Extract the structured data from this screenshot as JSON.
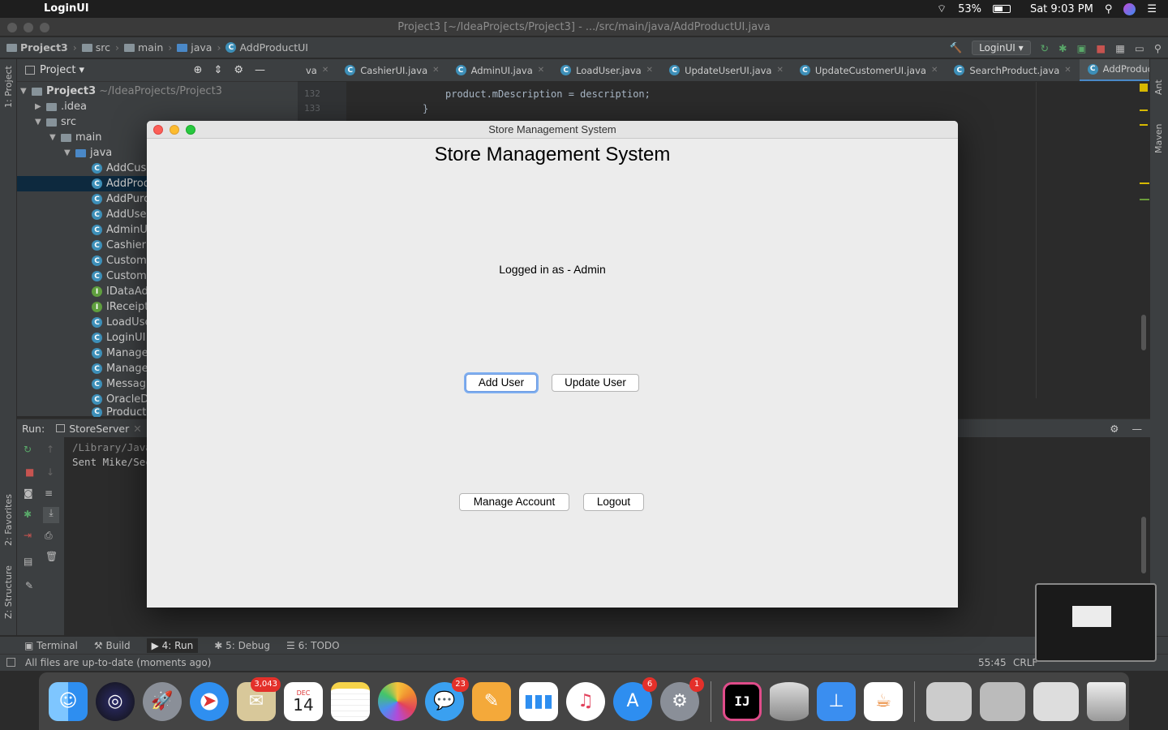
{
  "menubar": {
    "app_name": "LoginUI",
    "battery": "53%",
    "clock": "Sat 9:03 PM"
  },
  "window": {
    "title": "Project3 [~/IdeaProjects/Project3] - .../src/main/java/AddProductUI.java"
  },
  "breadcrumb": [
    "Project3",
    "src",
    "main",
    "java",
    "AddProductUI"
  ],
  "run_config": "LoginUI",
  "project_panel": {
    "title": "Project",
    "root": "Project3",
    "root_path": "~/IdeaProjects/Project3",
    "items": [
      {
        "label": ".idea",
        "type": "folder",
        "depth": 1
      },
      {
        "label": "src",
        "type": "folder",
        "depth": 1
      },
      {
        "label": "main",
        "type": "folder",
        "depth": 2
      },
      {
        "label": "java",
        "type": "folder",
        "depth": 3
      },
      {
        "label": "AddCus",
        "type": "class",
        "depth": 4
      },
      {
        "label": "AddProd",
        "type": "class",
        "depth": 4
      },
      {
        "label": "AddPurc",
        "type": "class",
        "depth": 4
      },
      {
        "label": "AddUse",
        "type": "class",
        "depth": 4
      },
      {
        "label": "AdminU",
        "type": "class",
        "depth": 4
      },
      {
        "label": "CashierU",
        "type": "class",
        "depth": 4
      },
      {
        "label": "Custom",
        "type": "class",
        "depth": 4
      },
      {
        "label": "Custom",
        "type": "class",
        "depth": 4
      },
      {
        "label": "IDataAd",
        "type": "interface",
        "depth": 4
      },
      {
        "label": "IReceipt",
        "type": "interface",
        "depth": 4
      },
      {
        "label": "LoadUse",
        "type": "class",
        "depth": 4
      },
      {
        "label": "LoginUI",
        "type": "class",
        "depth": 4
      },
      {
        "label": "Manage",
        "type": "class",
        "depth": 4
      },
      {
        "label": "Manage",
        "type": "class",
        "depth": 4
      },
      {
        "label": "Messag",
        "type": "class",
        "depth": 4
      },
      {
        "label": "OracleD",
        "type": "class",
        "depth": 4
      },
      {
        "label": "Product",
        "type": "class",
        "depth": 4
      }
    ]
  },
  "tabs": [
    "va",
    "CashierUI.java",
    "AdminUI.java",
    "LoadUser.java",
    "UpdateUserUI.java",
    "UpdateCustomerUI.java",
    "SearchProduct.java",
    "AddProductUI.java"
  ],
  "editor": {
    "lines": [
      {
        "num": "132",
        "code": "product.mDescription = description;"
      },
      {
        "num": "133",
        "code": "}"
      }
    ]
  },
  "run_panel": {
    "label": "Run:",
    "config": "StoreServer",
    "console": [
      "/Library/Java",
      "Sent Mike/Sec"
    ]
  },
  "bottom_tabs": [
    "Terminal",
    "Build",
    "4: Run",
    "5: Debug",
    "6: TODO"
  ],
  "status": {
    "message": "All files are up-to-date (moments ago)",
    "position": "55:45",
    "line_sep": "CRLF"
  },
  "side_labels": {
    "project": "1: Project",
    "favorites": "2: Favorites",
    "structure": "Z: Structure",
    "ant": "Ant",
    "maven": "Maven"
  },
  "dock": {
    "mail_badge": "3,043",
    "calendar_month": "DEC",
    "calendar_day": "14",
    "messages_badge": "23",
    "appstore_badge": "6",
    "prefs_badge": "1"
  },
  "dialog": {
    "window_title": "Store Management System",
    "heading": "Store Management System",
    "logged_in": "Logged in as - Admin",
    "buttons": {
      "add_user": "Add User",
      "update_user": "Update User",
      "manage_account": "Manage Account",
      "logout": "Logout"
    }
  }
}
